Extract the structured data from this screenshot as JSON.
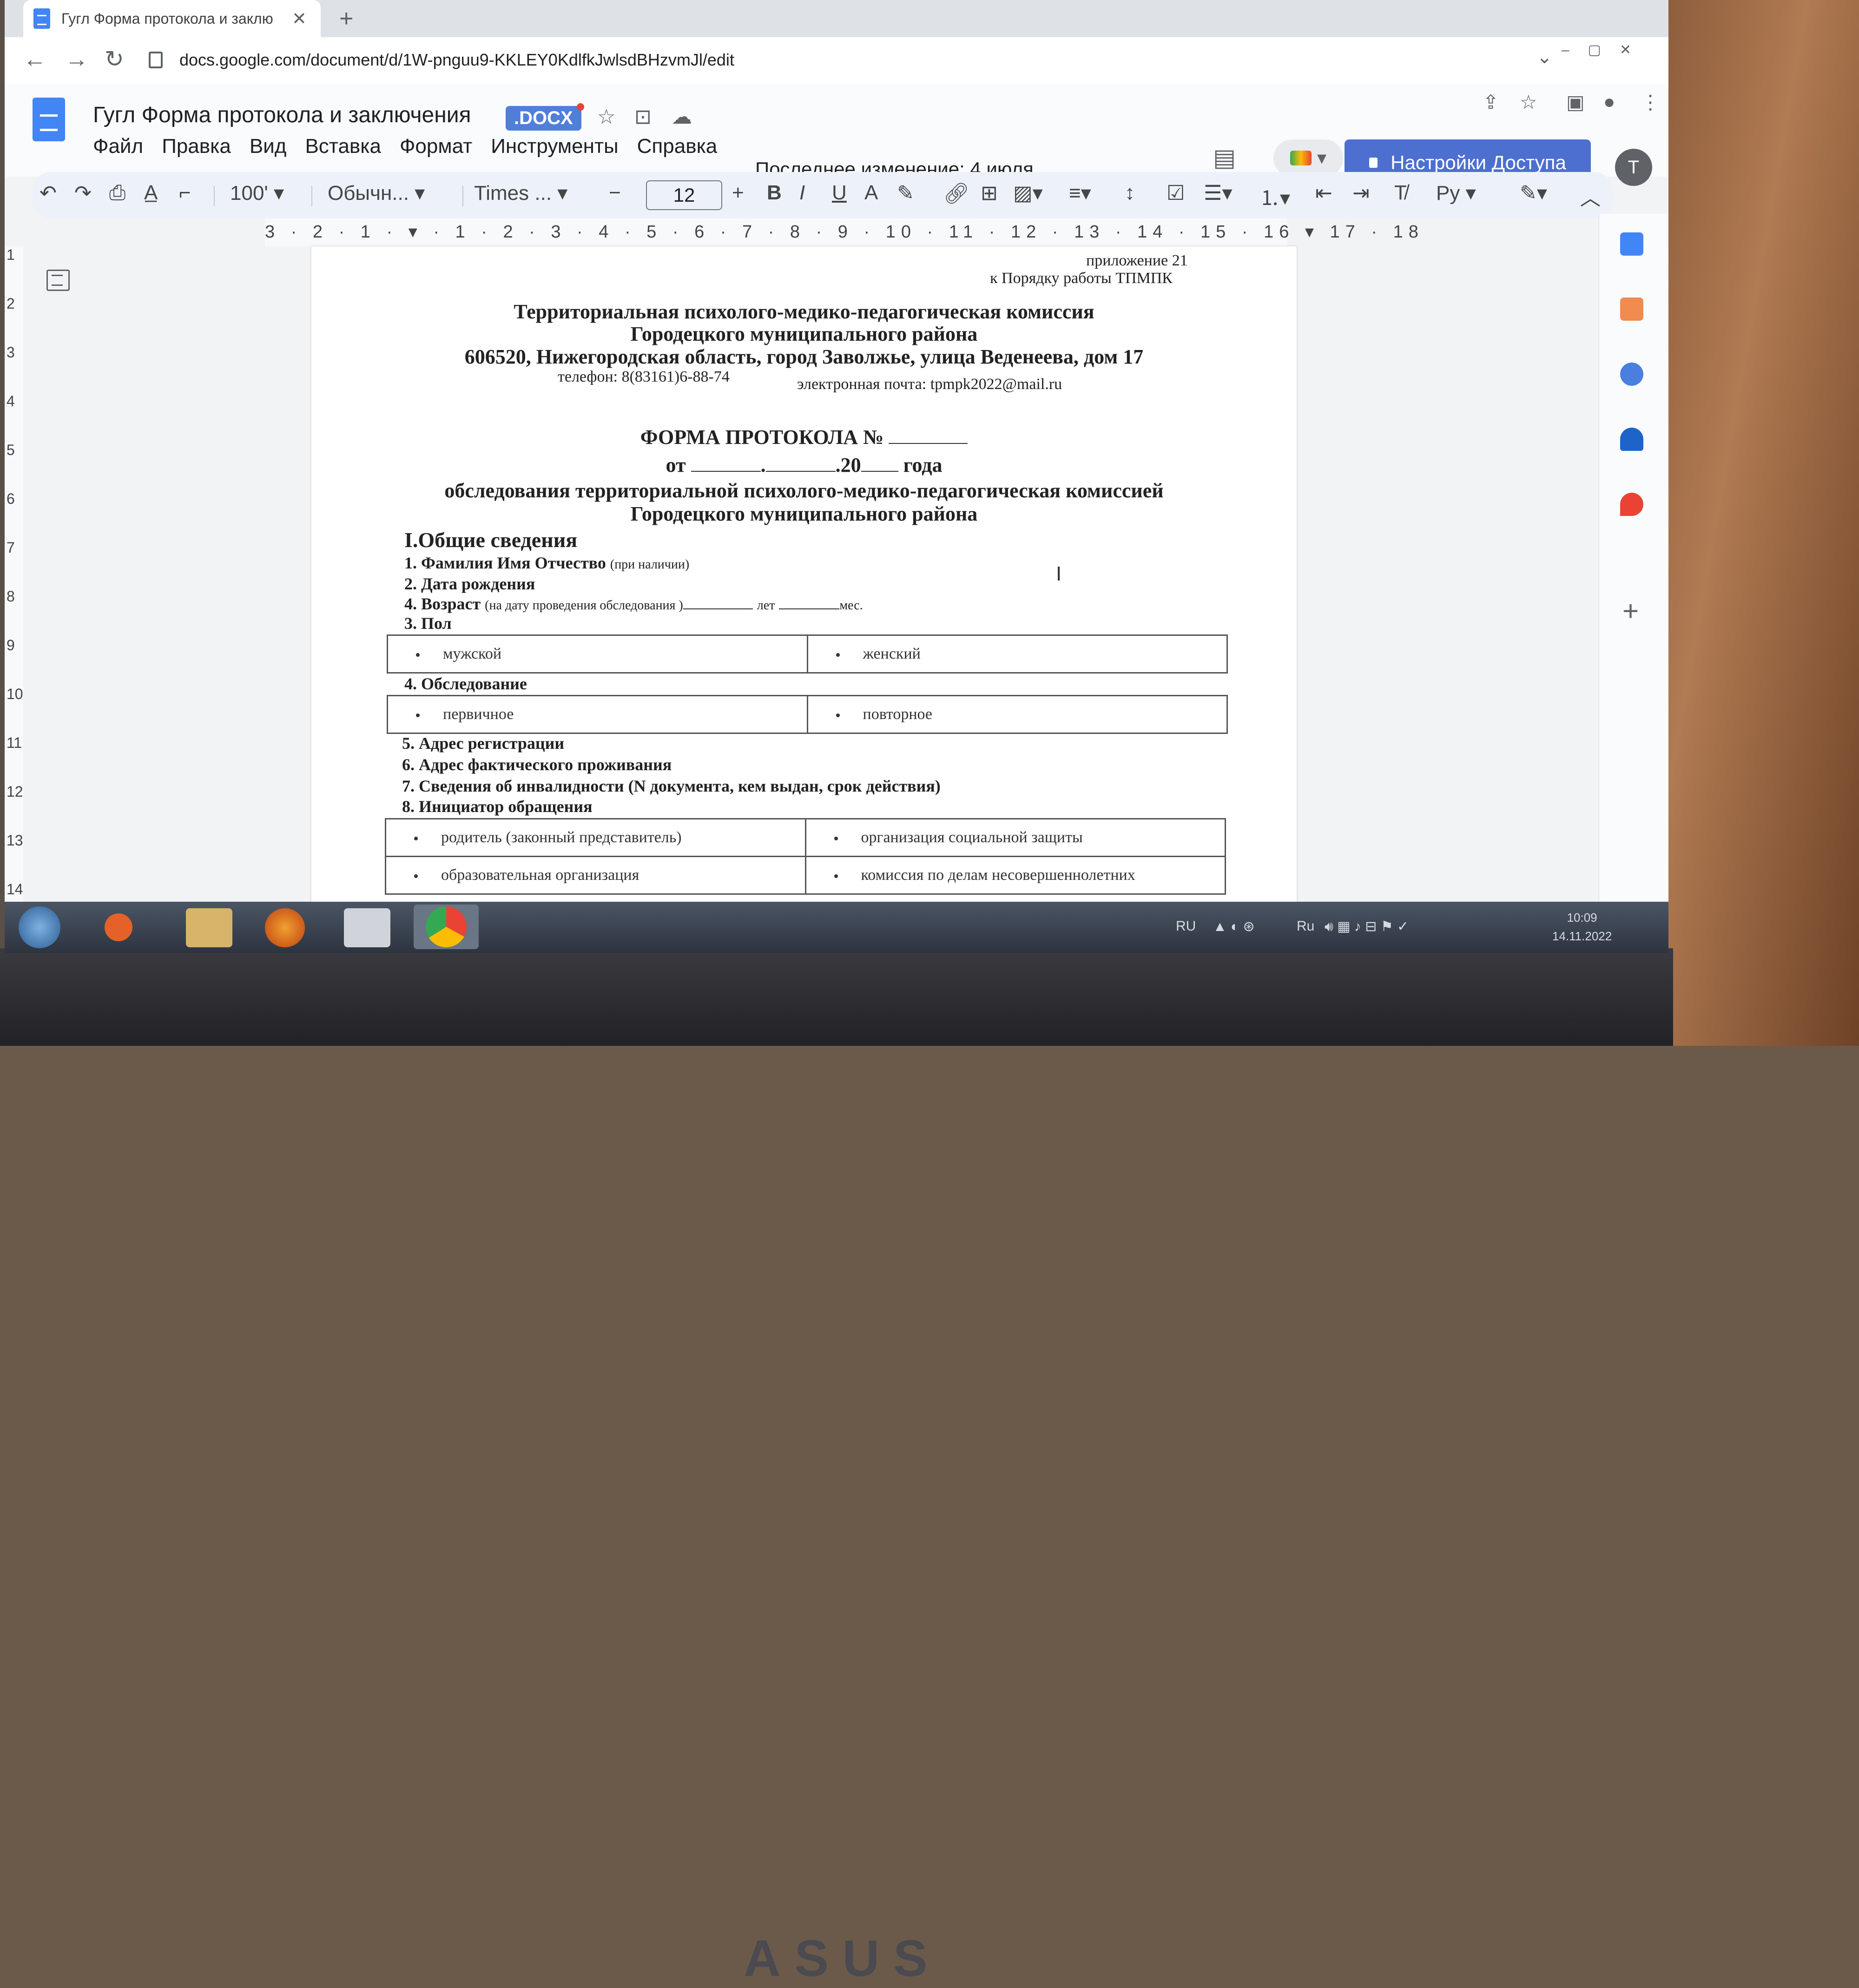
{
  "browser": {
    "tab_title": "Гугл Форма протокола и заклю",
    "url": "docs.google.com/document/d/1W-pnguu9-KKLEY0KdlfkJwlsdBHzvmJl/edit"
  },
  "docs": {
    "title": "Гугл Форма протокола и заключения",
    "badge": ".DOCX",
    "menu": [
      "Файл",
      "Правка",
      "Вид",
      "Вставка",
      "Формат",
      "Инструменты",
      "Справка"
    ],
    "last_edit": "Последнее изменение: 4 июля",
    "share_label": "Настройки Доступа",
    "avatar_letter": "T"
  },
  "toolbar": {
    "zoom": "100'",
    "style": "Обычн...",
    "font": "Times ...",
    "font_size": "12",
    "input_tools": "Ру"
  },
  "ruler": {
    "ticks": "3 · 2 · 1 · ▾ · 1 · 2 · 3 · 4 · 5 · 6 · 7 · 8 · 9 · 10 · 11 · 12 · 13 · 14 · 15 · 16 ▾ 17 · 18",
    "vertical": [
      "1",
      "2",
      "3",
      "4",
      "5",
      "6",
      "7",
      "8",
      "9",
      "10",
      "11",
      "12",
      "13",
      "14"
    ]
  },
  "document": {
    "appendix": "приложение 21",
    "appendix_sub": "к Порядку работы ТПМПК",
    "org_line1": "Территориальная психолого-медико-педагогическая комиссия",
    "org_line2": "Городецкого муниципального района",
    "org_address": "606520, Нижегородская область, город Заволжье, улица Веденеева, дом 17",
    "phone": "телефон: 8(83161)6-88-74",
    "email": "электронная почта: tpmpk2022@mail.ru",
    "form_title": "ФОРМА ПРОТОКОЛА  №",
    "date_prefix": "от",
    "date_year": ".20",
    "date_suffix": "года",
    "subtitle1": "обследования территориальной психолого-медико-педагогическая комиссией",
    "subtitle2": "Городецкого муниципального района",
    "section1": "I.Общие сведения",
    "field1": "1. Фамилия Имя Отчество",
    "field1_note": "(при наличии)",
    "field2": "2. Дата рождения",
    "field3": "4. Возраст",
    "field3_note": "(на дату проведения обследования )",
    "field3_years": "лет",
    "field3_months": "мес.",
    "field4": "3. Пол",
    "gender_options": [
      "мужской",
      "женский"
    ],
    "field5": "4. Обследование",
    "exam_options": [
      "первичное",
      "повторное"
    ],
    "field6": "5. Адрес регистрации",
    "field7": "6. Адрес фактического проживания",
    "field8": "7. Сведения об инвалидности (N документа, кем выдан, срок действия)",
    "field9": "8.  Инициатор обращения",
    "initiator_options": [
      [
        "родитель (законный представитель)",
        "организация социальной защиты"
      ],
      [
        "образовательная организация",
        "комиссия по делам несовершеннолетних"
      ]
    ]
  },
  "taskbar": {
    "lang": "RU",
    "tray_lang": "Ru",
    "time": "10:09",
    "date": "14.11.2022"
  }
}
